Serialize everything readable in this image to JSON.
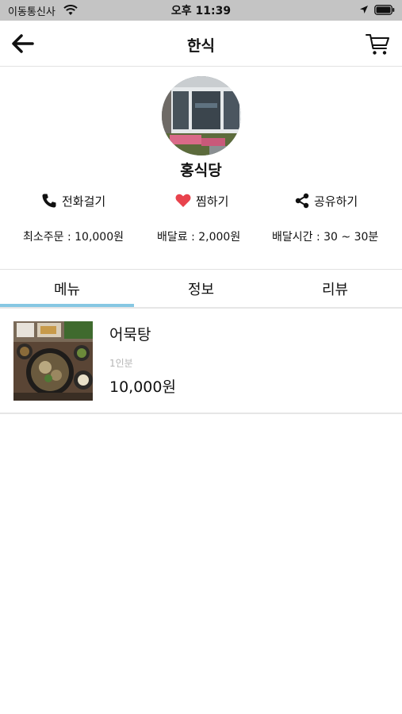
{
  "status_bar": {
    "carrier": "이동통신사",
    "time": "오후 11:39",
    "icons": [
      "wifi-icon",
      "location-arrow-icon",
      "battery-icon"
    ]
  },
  "header": {
    "title": "한식",
    "back_icon": "arrow-left-icon",
    "cart_icon": "cart-icon"
  },
  "store": {
    "name": "홍식당",
    "image": "store-photo"
  },
  "actions": {
    "call": "전화걸기",
    "favorite": "찜하기",
    "share": "공유하기"
  },
  "info": {
    "min_order": "최소주문 : 10,000원",
    "delivery_fee": "배달료 : 2,000원",
    "delivery_time": "배달시간 : 30 ~ 30분"
  },
  "tabs": [
    {
      "label": "메뉴",
      "active": true
    },
    {
      "label": "정보",
      "active": false
    },
    {
      "label": "리뷰",
      "active": false
    }
  ],
  "menu_items": [
    {
      "name": "어묵탕",
      "portion": "1인분",
      "price": "10,000원"
    }
  ],
  "colors": {
    "status_bar_bg": "#c4c4c4",
    "tab_indicator": "#86c7e3",
    "heart": "#e8434d",
    "divider": "#e2e2e2"
  }
}
